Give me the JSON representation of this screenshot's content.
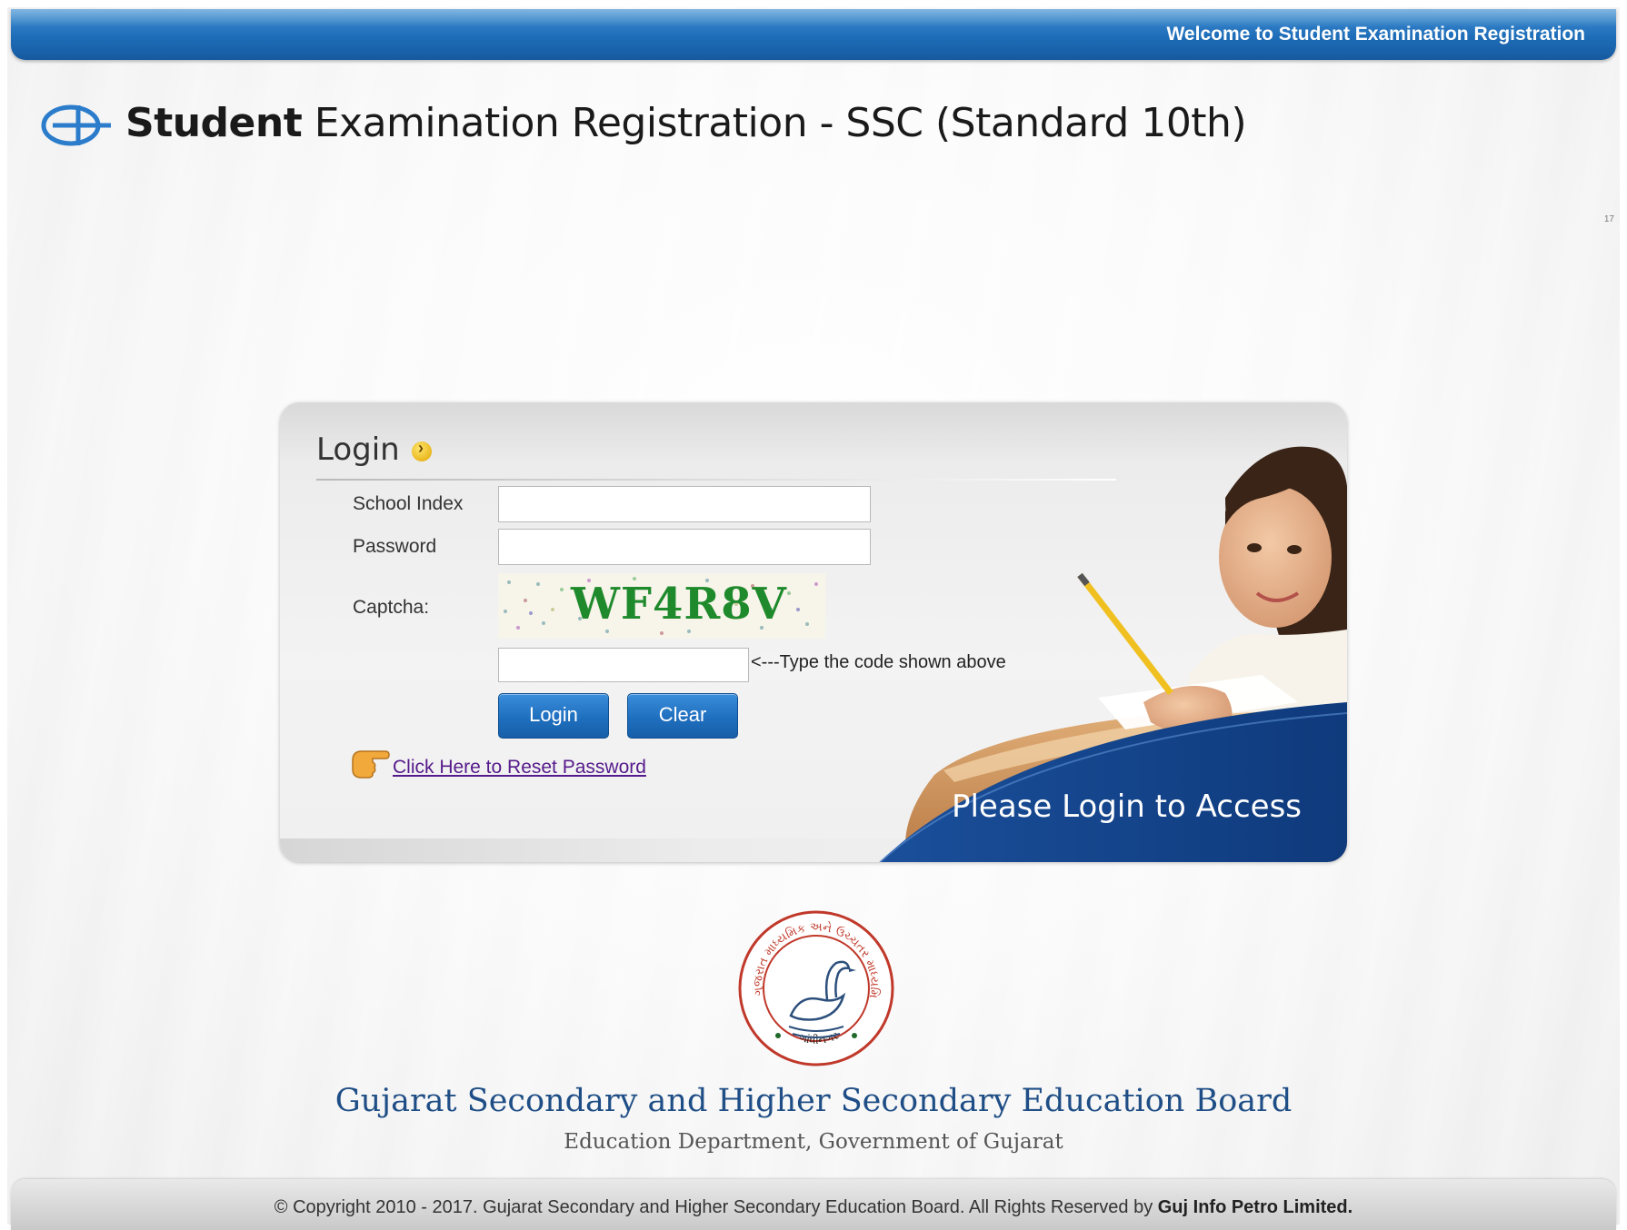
{
  "header": {
    "welcome": "Welcome to Student Examination Registration"
  },
  "brand": {
    "title_bold": "Student",
    "title_rest": " Examination Registration",
    "title_suffix": " - SSC (Standard 10th)",
    "corner_number": "17"
  },
  "login": {
    "title": "Login",
    "school_index_label": "School Index",
    "school_index_value": "",
    "password_label": "Password",
    "password_value": "",
    "captcha_label": "Captcha:",
    "captcha_code": "WF4R8V",
    "captcha_input_value": "",
    "captcha_hint": "<---Type the code shown above",
    "login_button": "Login",
    "clear_button": "Clear",
    "reset_link": "Click Here to Reset Password",
    "banner_text": "Please Login to Access"
  },
  "board": {
    "name": "Gujarat Secondary and Higher Secondary Education Board",
    "subtitle": "Education Department, Government of Gujarat",
    "seal_top_text": "ગુજરાત માધ્યમિક અને ઉચ્ચતર માધ્યમિક શિક્ષણ બોર્ડ",
    "seal_bottom_text": "ગાંધીનગર"
  },
  "footer": {
    "copyright": "© Copyright 2010 - 2017. Gujarat Secondary and Higher Secondary Education Board. All Rights Reserved by ",
    "company": "Guj Info Petro Limited."
  },
  "colors": {
    "header_blue": "#1e6db8",
    "button_blue": "#1f6fbf",
    "board_blue": "#1f4e86",
    "captcha_green": "#1f8a2c",
    "link_purple": "#551a8b"
  }
}
